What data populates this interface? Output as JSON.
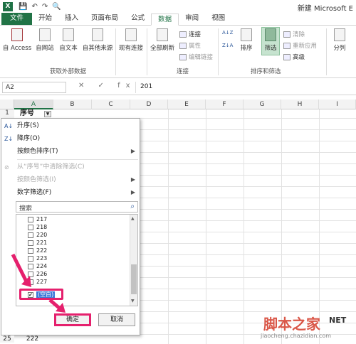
{
  "window": {
    "logo": "X",
    "title": "新建 Microsoft E"
  },
  "qat": [
    "💾",
    "↶",
    "↷",
    "🔍"
  ],
  "tabs": [
    "文件",
    "开始",
    "插入",
    "页面布局",
    "公式",
    "数据",
    "审阅",
    "视图"
  ],
  "ribbon": {
    "from_access": "自 Access",
    "from_web": "自网站",
    "from_text": "自文本",
    "from_other": "自其他来源",
    "existing": "现有连接",
    "refresh": "全部刷新",
    "connections": "连接",
    "properties": "属性",
    "edit_links": "编辑链接",
    "sort": "排序",
    "filter": "筛选",
    "clear": "清除",
    "reapply": "重新应用",
    "advanced": "高级",
    "split": "分列",
    "group_external": "获取外部数据",
    "group_conn": "连接",
    "group_sort": "排序和筛选",
    "az": "A↓Z",
    "za": "Z↓A"
  },
  "formula": {
    "namebox": "A2",
    "fx": "✕ ✓ fx",
    "content": "201"
  },
  "columns": [
    "A",
    "B",
    "C",
    "D",
    "E",
    "F",
    "G",
    "H",
    "I"
  ],
  "rows": {
    "r1": "1",
    "r25": "25",
    "r25_val": "222"
  },
  "cell_a1": "序号",
  "menu": {
    "sort_asc": "升序(S)",
    "sort_desc": "降序(O)",
    "sort_color": "按颜色排序(T)",
    "clear_filter": "从“序号”中清除筛选(C)",
    "filter_color": "按颜色筛选(I)",
    "number_filter": "数字筛选(F)",
    "search_placeholder": "搜索",
    "items": [
      "217",
      "218",
      "220",
      "221",
      "222",
      "223",
      "224",
      "226",
      "227"
    ],
    "blank": "(空白)",
    "ok": "确定",
    "cancel": "取消"
  },
  "watermark": {
    "main": "脚本之家",
    "url": "jiaocheng.chazidian.com",
    "ne": "NET",
    "accent": "#e5206d"
  }
}
